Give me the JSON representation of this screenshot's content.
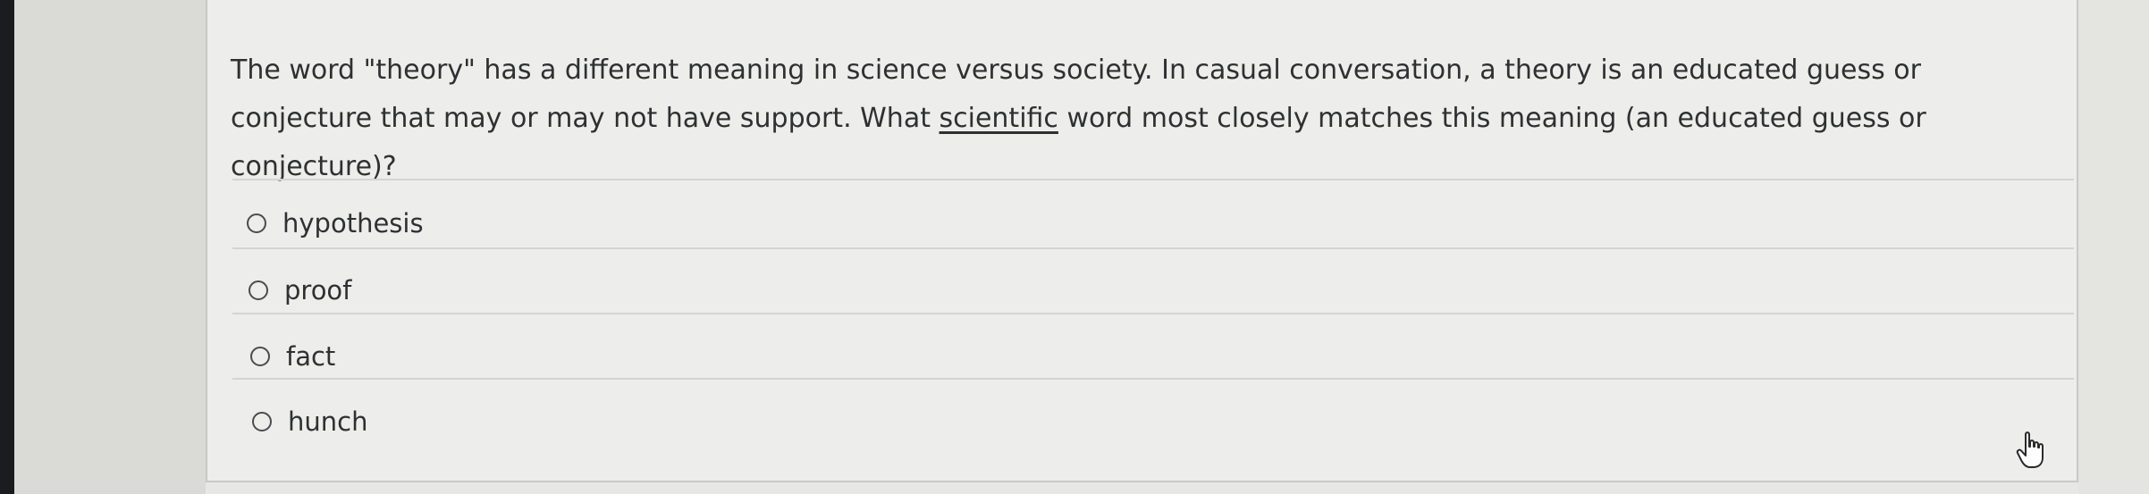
{
  "question": {
    "text_part1": "The word \"theory\" has a different meaning in science versus society. In casual conversation, a theory is an educated guess or conjecture that may or may not have support. What ",
    "underlined_word": "scientific",
    "text_part2": " word most closely matches this meaning (an educated guess or conjecture)?"
  },
  "options": [
    {
      "label": "hypothesis",
      "selected": false
    },
    {
      "label": "proof",
      "selected": false
    },
    {
      "label": "fact",
      "selected": false
    },
    {
      "label": "hunch",
      "selected": false
    }
  ],
  "cursor_icon": "hand-pointer-icon"
}
